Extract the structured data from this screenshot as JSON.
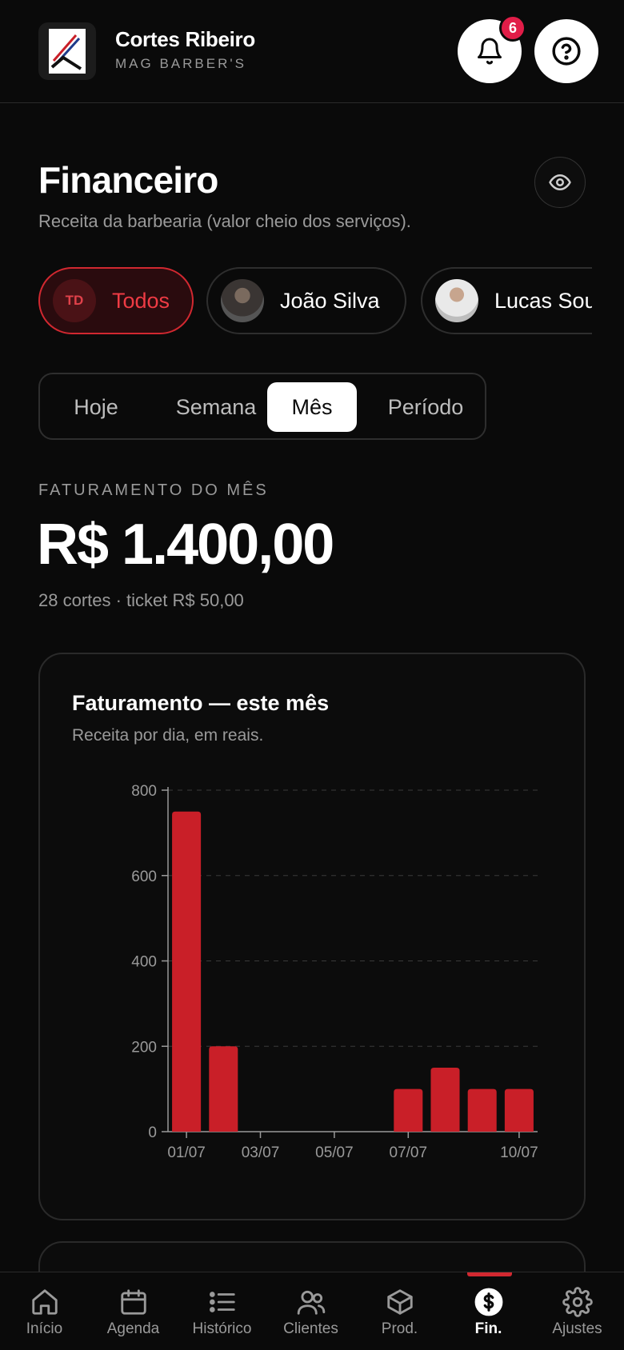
{
  "header": {
    "name": "Cortes Ribeiro",
    "shop": "MAG BARBER'S",
    "notifications_count": "6",
    "bell_icon": "bell-icon",
    "help_icon": "help-icon"
  },
  "page": {
    "title": "Financeiro",
    "subtitle": "Receita da barbearia (valor cheio dos serviços).",
    "visibility_icon": "eye-icon"
  },
  "filters": {
    "items": [
      {
        "label": "Todos",
        "initials": "TD",
        "active": true
      },
      {
        "label": "João Silva",
        "active": false
      },
      {
        "label": "Lucas Sou",
        "active": false
      }
    ]
  },
  "periods": {
    "items": [
      {
        "label": "Hoje"
      },
      {
        "label": "Semana"
      },
      {
        "label": "Mês",
        "active": true
      },
      {
        "label": "Período"
      }
    ]
  },
  "revenue": {
    "label": "FATURAMENTO DO MÊS",
    "value": "R$ 1.400,00",
    "meta": "28 cortes · ticket R$ 50,00"
  },
  "chart_card": {
    "title": "Faturamento — este mês",
    "subtitle": "Receita por dia, em reais."
  },
  "chart_data": {
    "type": "bar",
    "categories": [
      "01/07",
      "02/07",
      "03/07",
      "04/07",
      "05/07",
      "06/07",
      "07/07",
      "08/07",
      "09/07",
      "10/07"
    ],
    "values": [
      750,
      200,
      0,
      0,
      0,
      0,
      100,
      150,
      100,
      100
    ],
    "tick_labels_x": [
      "01/07",
      "03/07",
      "05/07",
      "07/07",
      "10/07"
    ],
    "yticks": [
      0,
      200,
      400,
      600,
      800
    ],
    "ylim": [
      0,
      800
    ],
    "grid": true,
    "bar_color": "#c91f28"
  },
  "colors": {
    "accent": "#d12830",
    "badge": "#e11d48",
    "background": "#0a0a0a"
  },
  "nav": {
    "items": [
      {
        "label": "Início",
        "icon": "home-icon"
      },
      {
        "label": "Agenda",
        "icon": "calendar-icon"
      },
      {
        "label": "Histórico",
        "icon": "list-icon"
      },
      {
        "label": "Clientes",
        "icon": "users-icon"
      },
      {
        "label": "Prod.",
        "icon": "box-icon"
      },
      {
        "label": "Fin.",
        "icon": "finance-icon",
        "active": true
      },
      {
        "label": "Ajustes",
        "icon": "gear-icon"
      }
    ]
  }
}
